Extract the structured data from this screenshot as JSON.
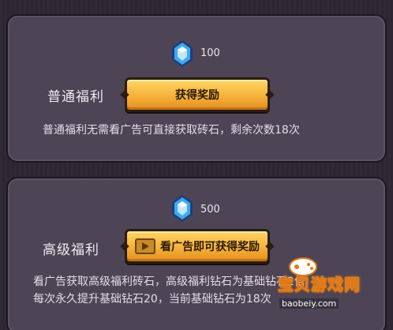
{
  "normal": {
    "gem_count": "100",
    "label": "普通福利",
    "button_label": "获得奖励",
    "description": "普通福利无需看广告可直接获取砖石，剩余次数18次"
  },
  "premium": {
    "gem_count": "500",
    "label": "高级福利",
    "button_label": "看广告即可获得奖励",
    "description_line1": "看广告获取高级福利砖石，高级福利钻石为基础钻石2倍",
    "description_line2": "每次永久提升基础钻石20，当前基础钻石为18次"
  },
  "watermark": {
    "text": "宝贝游戏网",
    "url": "baobeiy.com"
  },
  "colors": {
    "panel": "#4d4555",
    "button_gold": "#f6b13a",
    "gem_blue": "#3fa9f5"
  }
}
